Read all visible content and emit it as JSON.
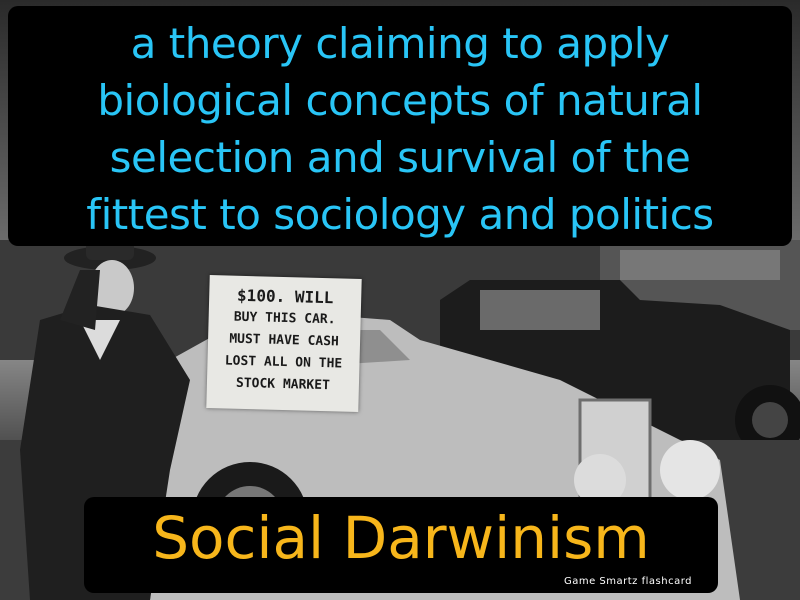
{
  "flashcard": {
    "definition_lines": [
      "a theory claiming to apply",
      "biological concepts of natural",
      "selection and survival of the",
      "fittest to sociology and politics"
    ],
    "term": "Social Darwinism",
    "brand": "Game  Smartz  flashcard",
    "colors": {
      "definition": "#29c5f6",
      "term": "#f7b61b",
      "box_background": "#000000"
    }
  },
  "photo": {
    "sign_lines": [
      "$100. WILL",
      "BUY THIS CAR.",
      "MUST HAVE CASH",
      "LOST ALL ON THE",
      "STOCK MARKET"
    ]
  }
}
